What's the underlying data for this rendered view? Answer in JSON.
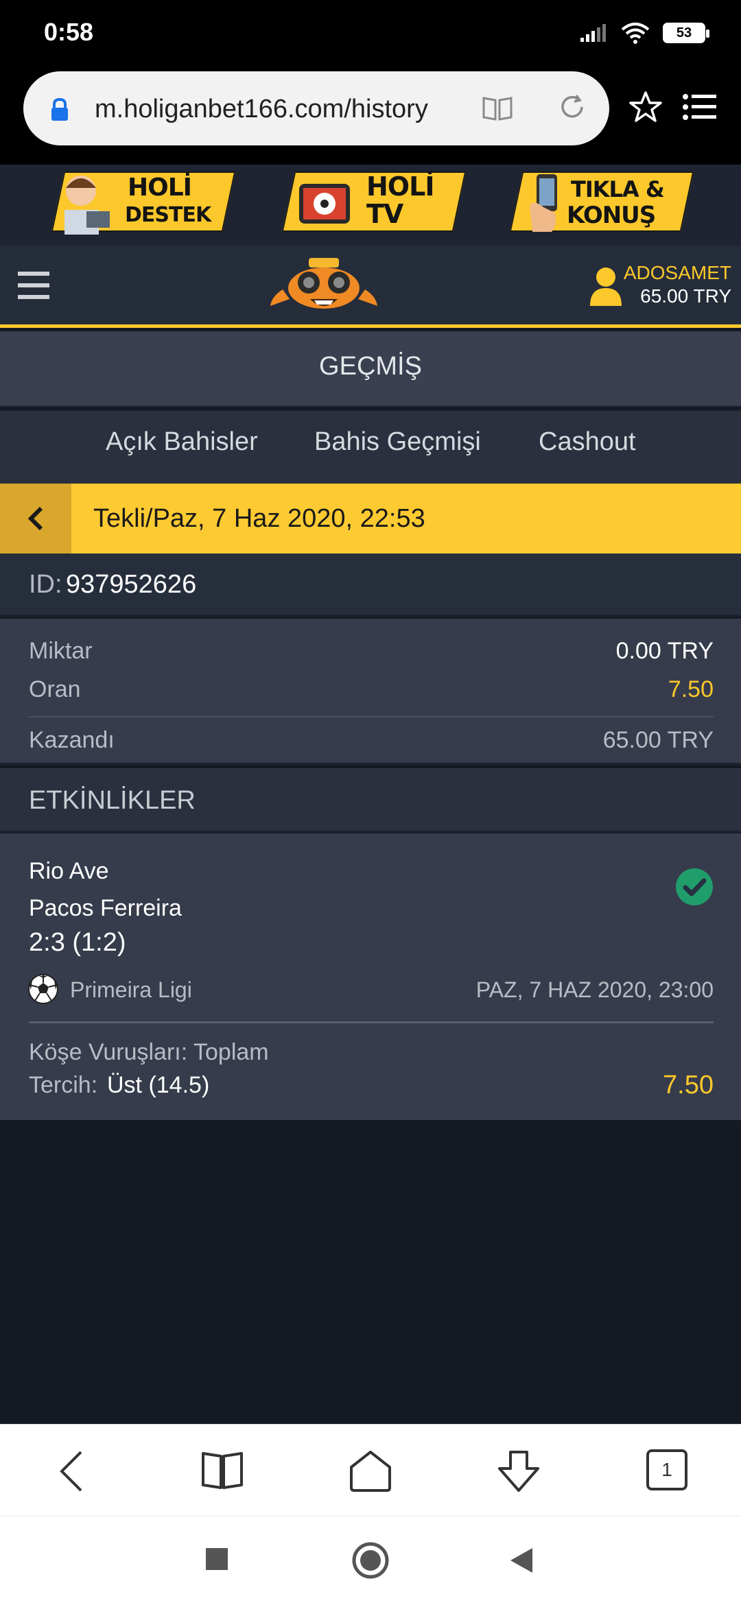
{
  "status": {
    "time": "0:58",
    "battery": "53"
  },
  "browser": {
    "url": "m.holiganbet166.com/history"
  },
  "banners": [
    {
      "line1": "HOLİ",
      "line2": "DESTEK"
    },
    {
      "line1": "HOLİ",
      "line2": "TV"
    },
    {
      "line1": "TIKLA &",
      "line2": "KONUŞ"
    }
  ],
  "header": {
    "username": "ADOSAMET",
    "balance": "65.00 TRY"
  },
  "page": {
    "title": "GEÇMİŞ"
  },
  "tabs": [
    "Açık Bahisler",
    "Bahis Geçmişi",
    "Cashout"
  ],
  "ticket": {
    "title": "Tekli/Paz, 7 Haz 2020, 22:53",
    "id_label": "ID:",
    "id_value": "937952626",
    "stake_label": "Miktar",
    "stake_value": "0.00 TRY",
    "odds_label": "Oran",
    "odds_value": "7.50",
    "result_label": "Kazandı",
    "result_value": "65.00 TRY"
  },
  "events": {
    "title": "ETKİNLİKLER",
    "items": [
      {
        "home": "Rio Ave",
        "away": "Pacos Ferreira",
        "score": "2:3 (1:2)",
        "league": "Primeira Ligi",
        "datetime": "PAZ, 7 HAZ 2020, 23:00",
        "market": "Köşe Vuruşları: Toplam",
        "pick_label": "Tercih:",
        "pick_value": "Üst (14.5)",
        "odds": "7.50"
      }
    ]
  },
  "browser_nav": {
    "tab_count": "1"
  },
  "colors": {
    "accent": "#fcc82b",
    "win": "#1f9d6b",
    "background": "#141a24"
  }
}
